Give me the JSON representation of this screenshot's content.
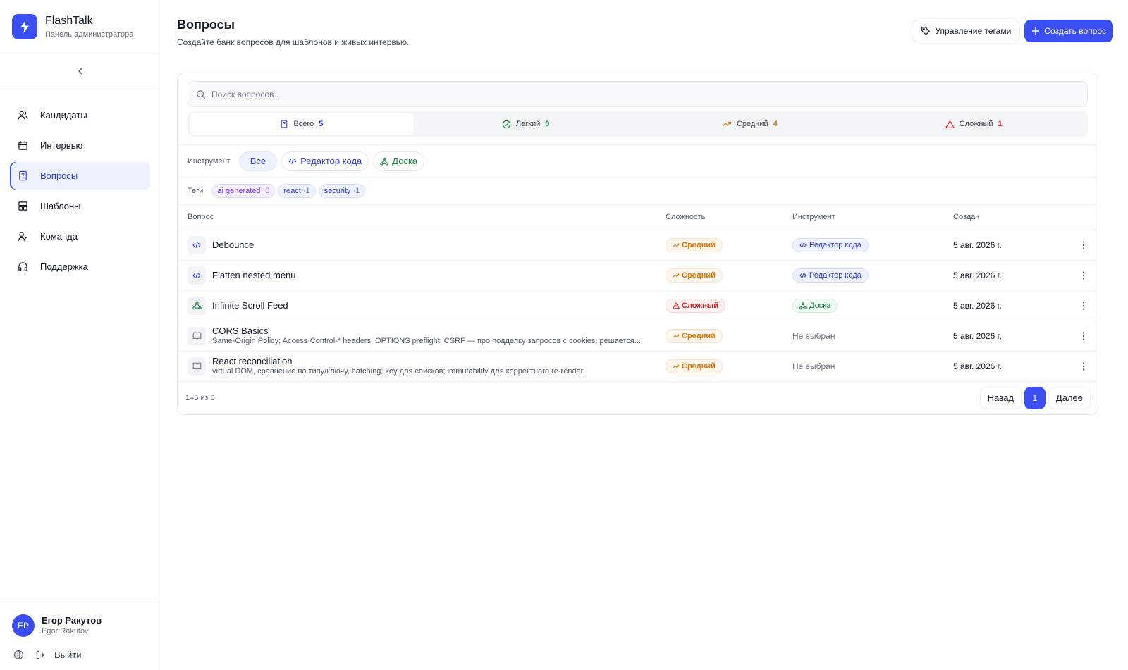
{
  "brand": {
    "name": "FlashTalk",
    "subtitle": "Панель администратора"
  },
  "sidebar": {
    "items": [
      {
        "label": "Кандидаты",
        "icon": "users-icon"
      },
      {
        "label": "Интервью",
        "icon": "calendar-icon"
      },
      {
        "label": "Вопросы",
        "icon": "file-question-icon",
        "active": true
      },
      {
        "label": "Шаблоны",
        "icon": "layout-template-icon"
      },
      {
        "label": "Команда",
        "icon": "team-icon"
      },
      {
        "label": "Поддержка",
        "icon": "headphones-icon"
      }
    ]
  },
  "user": {
    "initials": "ЕР",
    "name": "Егор Ракутов",
    "login": "Egor Rakutov"
  },
  "footer": {
    "logout_label": "Выйти"
  },
  "header": {
    "title": "Вопросы",
    "subtitle": "Создайте банк вопросов для шаблонов и живых интервью.",
    "manage_tags_label": "Управление тегами",
    "create_label": "Создать вопрос"
  },
  "search": {
    "placeholder": "Поиск вопросов...",
    "value": ""
  },
  "stats": [
    {
      "label": "Всего",
      "count": "5",
      "color": "#2f3fd6"
    },
    {
      "label": "Легкий",
      "count": "0",
      "color": "#15803d"
    },
    {
      "label": "Средний",
      "count": "4",
      "color": "#d97706"
    },
    {
      "label": "Сложный",
      "count": "1",
      "color": "#dc2626"
    }
  ],
  "tool_filter": {
    "label": "Инструмент",
    "all_label": "Все",
    "code_label": "Редактор кода",
    "board_label": "Доска"
  },
  "tags": {
    "label": "Теги",
    "items": [
      {
        "name": "ai generated",
        "count": "0",
        "style": "purple"
      },
      {
        "name": "react",
        "count": "1",
        "style": "blue"
      },
      {
        "name": "security",
        "count": "1",
        "style": "blue"
      }
    ]
  },
  "table": {
    "headers": {
      "question": "Вопрос",
      "difficulty": "Сложность",
      "tool": "Инструмент",
      "created": "Создан"
    },
    "rows": [
      {
        "title": "Debounce",
        "desc": "",
        "icon": "code-icon",
        "difficulty": "Средний",
        "difficulty_level": "medium",
        "tool": "Редактор кода",
        "tool_type": "code",
        "created": "5 авг. 2026 г."
      },
      {
        "title": "Flatten nested menu",
        "desc": "",
        "icon": "code-icon",
        "difficulty": "Средний",
        "difficulty_level": "medium",
        "tool": "Редактор кода",
        "tool_type": "code",
        "created": "5 авг. 2026 г."
      },
      {
        "title": "Infinite Scroll Feed",
        "desc": "",
        "icon": "board-icon",
        "difficulty": "Сложный",
        "difficulty_level": "hard",
        "tool": "Доска",
        "tool_type": "board",
        "created": "5 авг. 2026 г."
      },
      {
        "title": "CORS Basics",
        "desc": "Same-Origin Policy; Access-Control-* headers; OPTIONS preflight; CSRF — про подделку запросов с cookies, решается...",
        "icon": "book-icon",
        "difficulty": "Средний",
        "difficulty_level": "medium",
        "tool": "Не выбран",
        "tool_type": "none",
        "created": "5 авг. 2026 г."
      },
      {
        "title": "React reconciliation",
        "desc": "virtual DOM, сравнение по типу/ключу, batching; key для списков; immutability для корректного re-render.",
        "icon": "book-icon",
        "difficulty": "Средний",
        "difficulty_level": "medium",
        "tool": "Не выбран",
        "tool_type": "none",
        "created": "5 авг. 2026 г."
      }
    ]
  },
  "pagination": {
    "range": "1–5 из 5",
    "prev_label": "Назад",
    "current": "1",
    "next_label": "Далее"
  },
  "colors": {
    "accent": "#3b4ef0",
    "medium": "#d97706",
    "hard": "#dc2626",
    "easy": "#15803d"
  }
}
